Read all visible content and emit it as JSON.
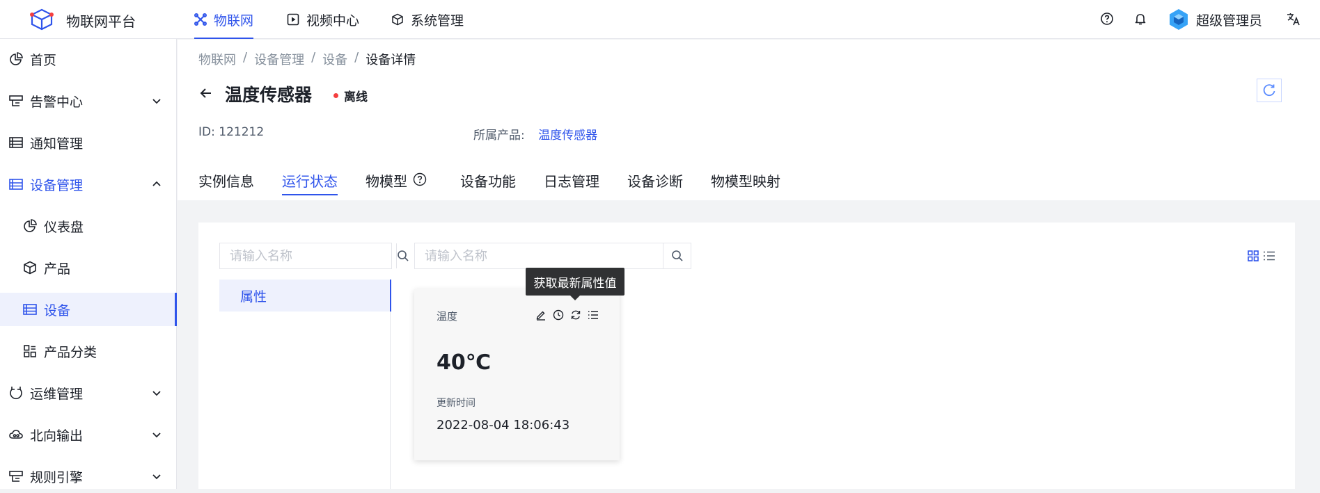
{
  "app": {
    "title": "物联网平台"
  },
  "topnav": [
    {
      "label": "物联网",
      "icon": "iot-icon",
      "active": true
    },
    {
      "label": "视频中心",
      "icon": "video-icon",
      "active": false
    },
    {
      "label": "系统管理",
      "icon": "cube-icon",
      "active": false
    }
  ],
  "header": {
    "user_name": "超级管理员"
  },
  "sidebar": {
    "items": [
      {
        "label": "首页"
      },
      {
        "label": "告警中心"
      },
      {
        "label": "通知管理"
      },
      {
        "label": "设备管理"
      },
      {
        "label": "仪表盘"
      },
      {
        "label": "产品"
      },
      {
        "label": "设备"
      },
      {
        "label": "产品分类"
      },
      {
        "label": "运维管理"
      },
      {
        "label": "北向输出"
      },
      {
        "label": "规则引擎"
      }
    ]
  },
  "breadcrumb": [
    "物联网",
    "设备管理",
    "设备",
    "设备详情"
  ],
  "breadcrumb_sep": "/",
  "device": {
    "name": "温度传感器",
    "status": "离线",
    "id_label": "ID:",
    "id": "121212",
    "product_label": "所属产品:",
    "product": "温度传感器"
  },
  "tabs": [
    {
      "label": "实例信息"
    },
    {
      "label": "运行状态",
      "active": true
    },
    {
      "label": "物模型"
    },
    {
      "label": "设备功能"
    },
    {
      "label": "日志管理"
    },
    {
      "label": "设备诊断"
    },
    {
      "label": "物模型映射"
    }
  ],
  "left_search": {
    "placeholder": "请输入名称"
  },
  "right_search": {
    "placeholder": "请输入名称"
  },
  "left_list": [
    {
      "label": "属性"
    }
  ],
  "property_card": {
    "name": "温度",
    "value": "40℃",
    "time_label": "更新时间",
    "time": "2022-08-04 18:06:43"
  },
  "tooltip": "获取最新属性值",
  "colors": {
    "accent": "#2f54eb",
    "offline": "#f53f3f",
    "tooltip_bg": "#303133"
  }
}
